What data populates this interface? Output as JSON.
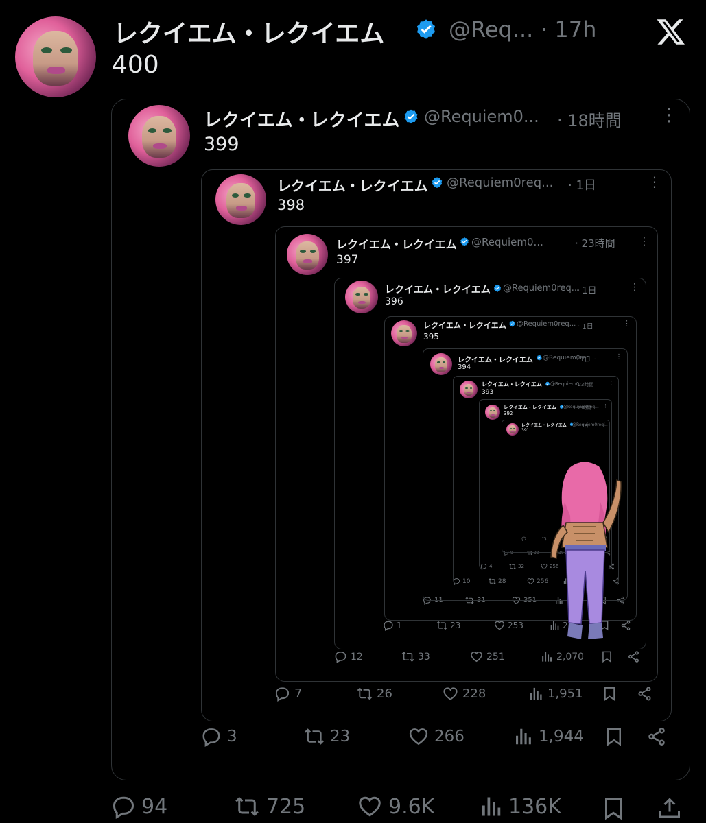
{
  "app": {
    "logo": "X"
  },
  "main_tweet": {
    "name": "レクイエム・レクイエム",
    "handle": "@Req...",
    "time": "· 17h",
    "text": "400",
    "replies": "94",
    "reposts": "725",
    "likes": "9.6K",
    "views": "136K"
  },
  "quotes": [
    {
      "name": "レクイエム・レクイエム",
      "handle": "@Requiem0...",
      "time": "· 18時間",
      "text": "399",
      "replies": "3",
      "reposts": "23",
      "likes": "266",
      "views": "1,944"
    },
    {
      "name": "レクイエム・レクイエム",
      "handle": "@Requiem0req...",
      "time": "· 1日",
      "text": "398",
      "replies": "7",
      "reposts": "26",
      "likes": "228",
      "views": "1,951"
    },
    {
      "name": "レクイエム・レクイエム",
      "handle": "@Requiem0...",
      "time": "· 23時間",
      "text": "397",
      "replies": "12",
      "reposts": "33",
      "likes": "251",
      "views": "2,070"
    },
    {
      "name": "レクイエム・レクイエム",
      "handle": "@Requiem0req...",
      "time": "· 1日",
      "text": "396",
      "replies": "1",
      "reposts": "23",
      "likes": "253",
      "views": "2,..."
    },
    {
      "name": "レクイエム・レクイエム",
      "handle": "@Requiem0req...",
      "time": "· 1日",
      "text": "395",
      "replies": "11",
      "reposts": "31",
      "likes": "351",
      "views": ""
    },
    {
      "name": "レクイエム・レクイエム",
      "handle": "@Requiem0req...",
      "time": "· 1日",
      "text": "394",
      "replies": "10",
      "reposts": "28",
      "likes": "256",
      "views": ""
    },
    {
      "name": "レクイエム・レクイエム",
      "handle": "@Requiem0...",
      "time": "· 23時間",
      "text": "393",
      "replies": "4",
      "reposts": "32",
      "likes": "256",
      "views": ""
    },
    {
      "name": "レクイエム・レクイエム",
      "handle": "@Requiem0req...",
      "time": "· 23時間",
      "text": "392",
      "replies": "9",
      "reposts": "30",
      "likes": "304",
      "views": ""
    },
    {
      "name": "レクイエム・レクイエム",
      "handle": "@Requiem0req...",
      "time": "· 1日",
      "text": "391",
      "replies": "",
      "reposts": "",
      "likes": "",
      "views": ""
    }
  ]
}
